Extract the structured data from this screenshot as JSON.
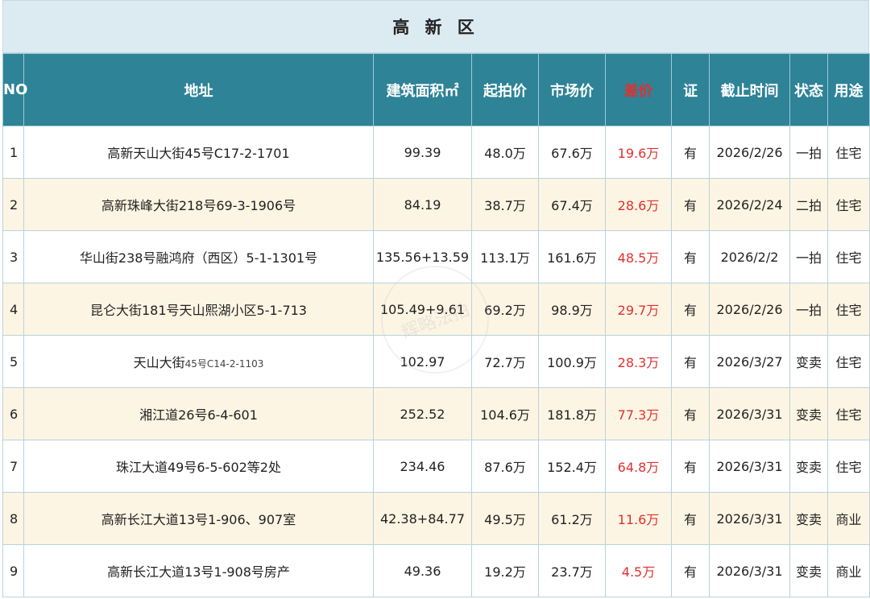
{
  "title": "高 新 区",
  "headers": {
    "no": "NO",
    "address": "地址",
    "area": "建筑面积㎡",
    "start_price": "起拍价",
    "market_price": "市场价",
    "diff": "差价",
    "cert": "证",
    "deadline": "截止时间",
    "status": "状态",
    "usage": "用途"
  },
  "rows": [
    {
      "no": "1",
      "address": "高新天山大街45号C17-2-1701",
      "area": "99.39",
      "start_price": "48.0万",
      "market_price": "67.6万",
      "diff": "19.6万",
      "cert": "有",
      "deadline": "2026/2/26",
      "status": "一拍",
      "usage": "住宅"
    },
    {
      "no": "2",
      "address": "高新珠峰大街218号69-3-1906号",
      "area": "84.19",
      "start_price": "38.7万",
      "market_price": "67.4万",
      "diff": "28.6万",
      "cert": "有",
      "deadline": "2026/2/24",
      "status": "二拍",
      "usage": "住宅"
    },
    {
      "no": "3",
      "address": "华山街238号融鸿府（西区）5-1-1301号",
      "area": "135.56+13.59",
      "start_price": "113.1万",
      "market_price": "161.6万",
      "diff": "48.5万",
      "cert": "有",
      "deadline": "2026/2/2",
      "status": "一拍",
      "usage": "住宅"
    },
    {
      "no": "4",
      "address": "昆仑大街181号天山熙湖小区5-1-713",
      "area": "105.49+9.61",
      "start_price": "69.2万",
      "market_price": "98.9万",
      "diff": "29.7万",
      "cert": "有",
      "deadline": "2026/2/26",
      "status": "一拍",
      "usage": "住宅"
    },
    {
      "no": "5",
      "address": "天山大街",
      "address_small": "45号C14-2-1103",
      "area": "102.97",
      "start_price": "72.7万",
      "market_price": "100.9万",
      "diff": "28.3万",
      "cert": "有",
      "deadline": "2026/3/27",
      "status": "变卖",
      "usage": "住宅"
    },
    {
      "no": "6",
      "address": "湘江道26号6-4-601",
      "area": "252.52",
      "start_price": "104.6万",
      "market_price": "181.8万",
      "diff": "77.3万",
      "cert": "有",
      "deadline": "2026/3/31",
      "status": "变卖",
      "usage": "住宅"
    },
    {
      "no": "7",
      "address": "珠江大道49号6-5-602等2处",
      "area": "234.46",
      "start_price": "87.6万",
      "market_price": "152.4万",
      "diff": "64.8万",
      "cert": "有",
      "deadline": "2026/3/31",
      "status": "变卖",
      "usage": "住宅"
    },
    {
      "no": "8",
      "address": "高新长江大道13号1-906、907室",
      "area": "42.38+84.77",
      "start_price": "49.5万",
      "market_price": "61.2万",
      "diff": "11.6万",
      "cert": "有",
      "deadline": "2026/3/31",
      "status": "变卖",
      "usage": "商业"
    },
    {
      "no": "9",
      "address": "高新长江大道13号1-908号房产",
      "area": "49.36",
      "start_price": "19.2万",
      "market_price": "23.7万",
      "diff": "4.5万",
      "cert": "有",
      "deadline": "2026/3/31",
      "status": "变卖",
      "usage": "商业"
    }
  ],
  "watermark": "辉略法拍",
  "colors": {
    "header_bg": "#2e8397",
    "title_bg": "#dcebf1",
    "alt_row_bg": "#fdf5e3",
    "diff_red": "#e03030"
  }
}
